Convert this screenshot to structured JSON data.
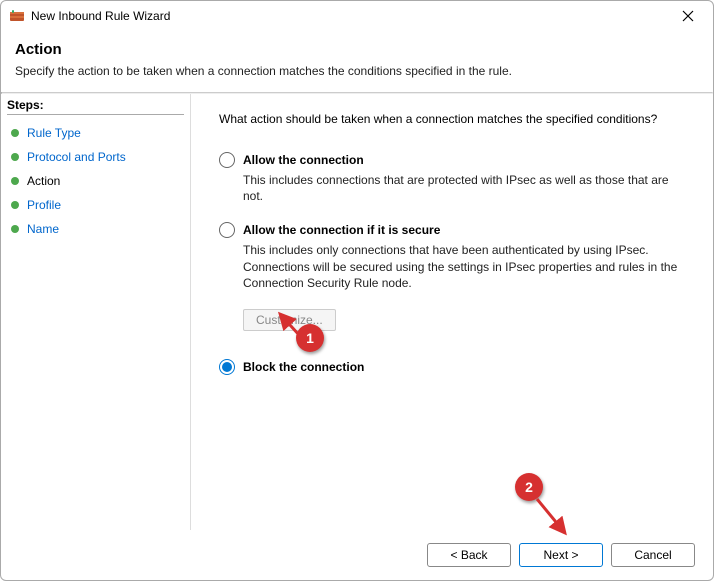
{
  "titlebar": {
    "title": "New Inbound Rule Wizard"
  },
  "header": {
    "title": "Action",
    "subtitle": "Specify the action to be taken when a connection matches the conditions specified in the rule."
  },
  "sidebar": {
    "title": "Steps:",
    "items": [
      {
        "label": "Rule Type",
        "state": "link"
      },
      {
        "label": "Protocol and Ports",
        "state": "link"
      },
      {
        "label": "Action",
        "state": "current"
      },
      {
        "label": "Profile",
        "state": "link"
      },
      {
        "label": "Name",
        "state": "link"
      }
    ]
  },
  "main": {
    "prompt": "What action should be taken when a connection matches the specified conditions?",
    "options": [
      {
        "label": "Allow the connection",
        "desc": "This includes connections that are protected with IPsec as well as those that are not.",
        "selected": false
      },
      {
        "label": "Allow the connection if it is secure",
        "desc": "This includes only connections that have been authenticated by using IPsec.  Connections will be secured using the settings in IPsec properties and rules in the Connection Security Rule node.",
        "selected": false
      },
      {
        "label": "Block the connection",
        "desc": "",
        "selected": true
      }
    ],
    "customize_label": "Customize..."
  },
  "footer": {
    "back": "< Back",
    "next": "Next >",
    "cancel": "Cancel"
  },
  "annotations": {
    "a1": "1",
    "a2": "2"
  }
}
